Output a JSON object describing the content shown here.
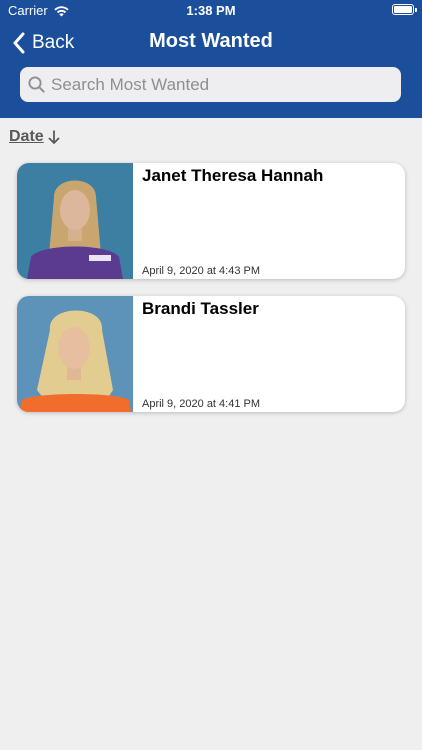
{
  "status_bar": {
    "carrier": "Carrier",
    "time": "1:38 PM",
    "wifi_icon": "wifi-icon",
    "battery_icon": "battery-icon"
  },
  "nav": {
    "back_label": "Back",
    "back_icon": "chevron-left-icon",
    "title": "Most Wanted"
  },
  "search": {
    "placeholder": "Search Most Wanted",
    "value": "",
    "icon": "search-icon"
  },
  "sort": {
    "label": "Date",
    "icon": "arrow-down-icon"
  },
  "results": [
    {
      "name": "Janet Theresa Hannah",
      "date": "April 9, 2020 at 4:43 PM"
    },
    {
      "name": "Brandi Tassler",
      "date": "April 9, 2020 at 4:41 PM"
    }
  ],
  "colors": {
    "header_bg": "#1b4f9c",
    "page_bg": "#efeff0",
    "card_bg": "#ffffff"
  }
}
